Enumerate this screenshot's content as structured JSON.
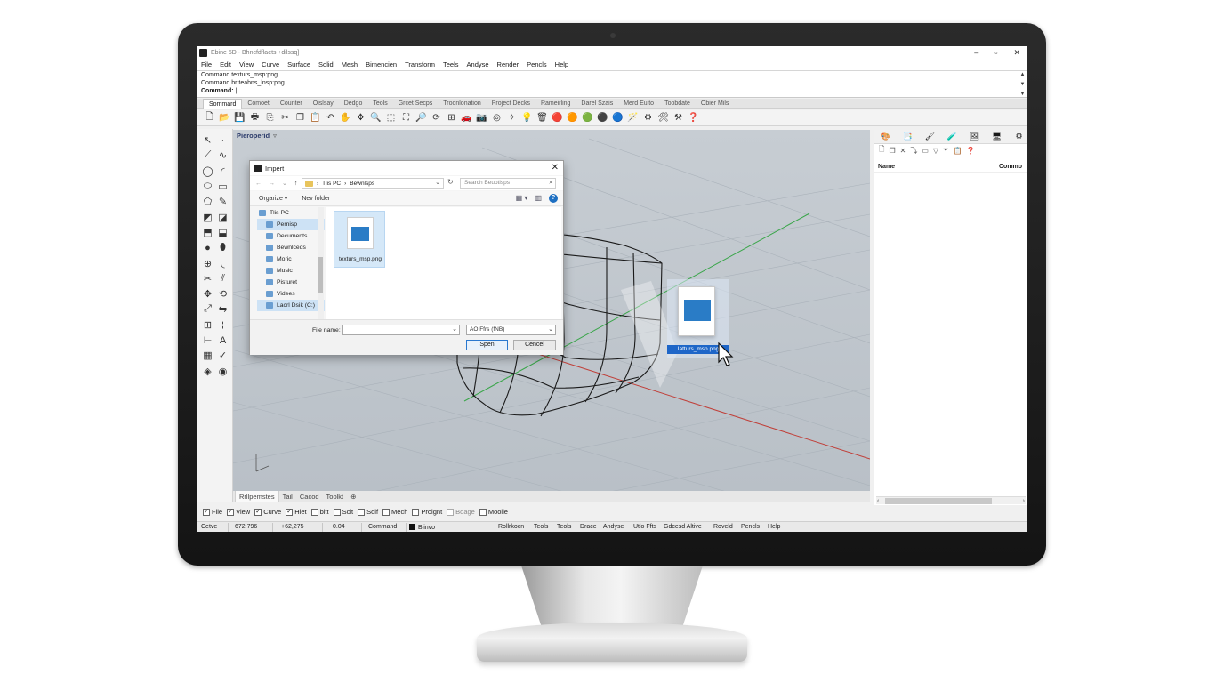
{
  "window": {
    "title": "Ebine 5D - Bhncfdflaets ÷dilssq]",
    "controls": [
      "–",
      "▫",
      "✕"
    ]
  },
  "menu": [
    "File",
    "Edit",
    "View",
    "Curve",
    "Surface",
    "Solid",
    "Mesh",
    "Bimencien",
    "Transform",
    "Teels",
    "Andyse",
    "Render",
    "Pencls",
    "Help"
  ],
  "command": {
    "lines": [
      "Command texturs_msp:png",
      "Command br teahns_lnsp:png"
    ],
    "prompt": "Command:"
  },
  "toolbar_tabs": {
    "active": "Sommard",
    "items": [
      "Comoet",
      "Counter",
      "Oislsay",
      "Dedgo",
      "Teols",
      "Grcet Secps",
      "Troonlonation",
      "Project Decks",
      "Rameirling",
      "Darel Szais",
      "Merd Eulto",
      "Toobdate",
      "Obier Mils"
    ]
  },
  "viewport": {
    "title": "Pieroperid",
    "title_caret": "▿",
    "tabs": [
      {
        "label": "Rrllpemstes",
        "active": true
      },
      {
        "label": "Tail",
        "active": false
      },
      {
        "label": "Cacod",
        "active": false
      },
      {
        "label": "Toolkt",
        "active": false
      },
      {
        "label": "⊕",
        "active": false
      }
    ]
  },
  "right_panel": {
    "col_name": "Name",
    "col_comment": "Commo"
  },
  "osnap": [
    {
      "label": "File",
      "checked": true,
      "enabled": true
    },
    {
      "label": "View",
      "checked": true,
      "enabled": true
    },
    {
      "label": "Curve",
      "checked": true,
      "enabled": true
    },
    {
      "label": "Hlet",
      "checked": true,
      "enabled": true
    },
    {
      "label": "bltt",
      "checked": false,
      "enabled": true
    },
    {
      "label": "Scit",
      "checked": false,
      "enabled": true
    },
    {
      "label": "Soif",
      "checked": false,
      "enabled": true
    },
    {
      "label": "Mech",
      "checked": false,
      "enabled": true
    },
    {
      "label": "Proignt",
      "checked": false,
      "enabled": true
    },
    {
      "label": "Boage",
      "checked": false,
      "enabled": false
    },
    {
      "label": "Moolle",
      "checked": false,
      "enabled": true
    }
  ],
  "status": {
    "cplane": "Cetve",
    "x": "672.796",
    "y": "+62,275",
    "z": "0.04",
    "units": "Command",
    "layer": "Blinvo",
    "items": [
      "Rollrkocn",
      "Teols",
      "Teols",
      "Drace",
      "Andyse",
      "Utlo Ffts",
      "Gdcesd Altive",
      "Roveld",
      "Pencls",
      "Help"
    ]
  },
  "dialog": {
    "title": "Impert",
    "close": "✕",
    "nav": {
      "back": "←",
      "forward": "→",
      "down": "⌄",
      "up": "↑"
    },
    "breadcrumb": [
      "Tlis PC",
      "Bewnlsps"
    ],
    "breadcrumb_sep": "›",
    "search_placeholder": "Search Beuotlsps",
    "organize": "Orgarize ▾",
    "new_folder": "Nev folder",
    "tree": [
      {
        "label": "Tlis PC",
        "root": true,
        "selected": false
      },
      {
        "label": "Pernisp",
        "root": false,
        "selected": true
      },
      {
        "label": "Decuments",
        "root": false,
        "selected": false
      },
      {
        "label": "Bewnlceds",
        "root": false,
        "selected": false
      },
      {
        "label": "Moric",
        "root": false,
        "selected": false
      },
      {
        "label": "Music",
        "root": false,
        "selected": false
      },
      {
        "label": "Pisturet",
        "root": false,
        "selected": false
      },
      {
        "label": "Videes",
        "root": false,
        "selected": false
      },
      {
        "label": "Lacrl Dsik (C:)",
        "root": false,
        "selected": true
      }
    ],
    "file": {
      "name": "texturs_msp.png"
    },
    "file_name_label": "File name:",
    "file_name_value": "",
    "file_type": "AO Ffrs (fNB)",
    "open_label": "Spen",
    "cancel_label": "Cencel"
  },
  "drag": {
    "label": "Iatturs_msp.png"
  }
}
